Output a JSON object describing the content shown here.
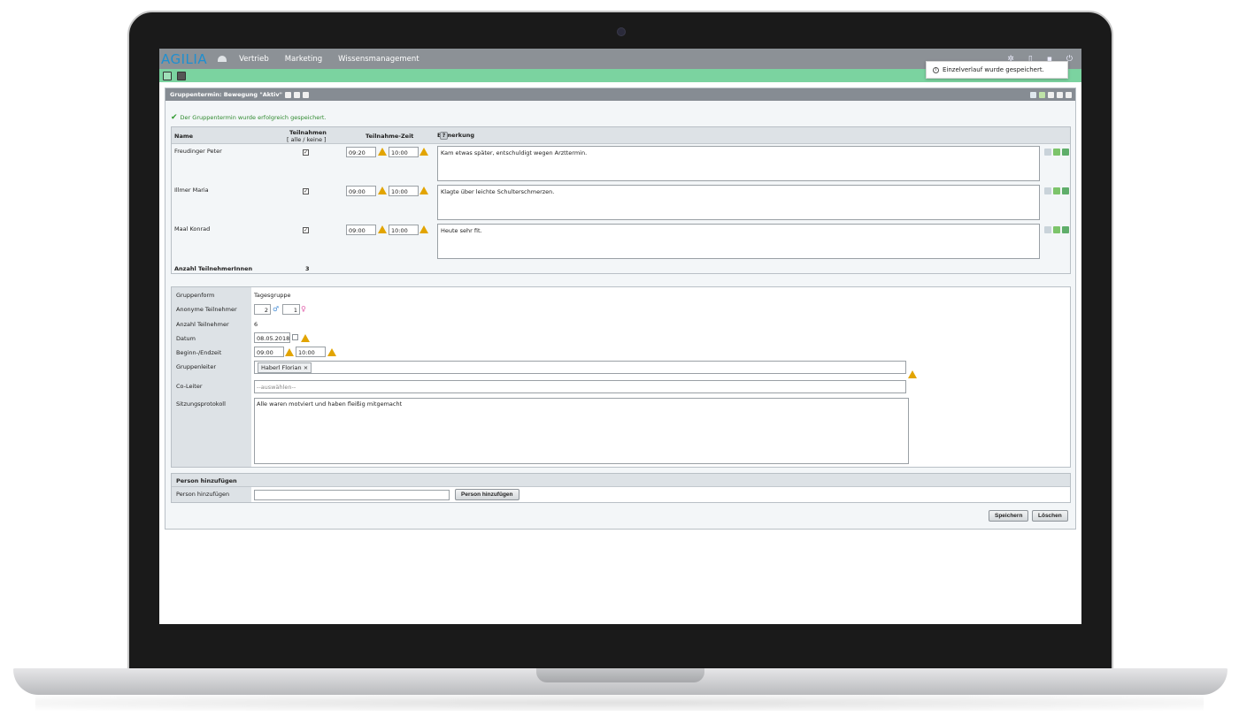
{
  "app": {
    "logo": "AGILIA",
    "nav": [
      "Vertrieb",
      "Marketing",
      "Wissensmanagement"
    ]
  },
  "toast": {
    "message": "Einzelverlauf wurde gespeichert."
  },
  "panel": {
    "title": "Gruppentermin: Bewegung \"Aktiv\"",
    "success_message": "Der Gruppentermin wurde erfolgreich gespeichert."
  },
  "participants": {
    "headers": {
      "name": "Name",
      "teilnahmen": "Teilnahmen",
      "alle_keine": "[ alle / keine ]",
      "zeit": "Teilnahme-Zeit",
      "bemerkung": "Bemerkung",
      "help": "?"
    },
    "rows": [
      {
        "name": "Freudinger Peter",
        "checked": true,
        "start": "09:20",
        "end": "10:00",
        "remark": "Kam etwas später, entschuldigt wegen Arzttermin."
      },
      {
        "name": "Illmer Maria",
        "checked": true,
        "start": "09:00",
        "end": "10:00",
        "remark": "Klagte über leichte Schulterschmerzen."
      },
      {
        "name": "Maal Konrad",
        "checked": true,
        "start": "09:00",
        "end": "10:00",
        "remark": "Heute sehr fit."
      }
    ],
    "count_label": "Anzahl TeilnehmerInnen",
    "count_value": "3"
  },
  "form": {
    "gruppenform_label": "Gruppenform",
    "gruppenform_value": "Tagesgruppe",
    "anonym_label": "Anonyme Teilnehmer",
    "anonym_male": "2",
    "anonym_female": "1",
    "anzahl_label": "Anzahl Teilnehmer",
    "anzahl_value": "6",
    "datum_label": "Datum",
    "datum_value": "08.05.2018",
    "zeit_label": "Beginn-/Endzeit",
    "beginn": "09:00",
    "ende": "10:00",
    "leiter_label": "Gruppenleiter",
    "leiter_tag": "Haberl Florian",
    "coleiter_label": "Co-Leiter",
    "coleiter_placeholder": "--auswählen--",
    "protokoll_label": "Sitzungsprotokoll",
    "protokoll_value": "Alle waren motviert und haben fleißig mitgemacht"
  },
  "add_person": {
    "section_title": "Person hinzufügen",
    "label": "Person hinzufügen",
    "button": "Person hinzufügen"
  },
  "actions": {
    "save": "Speichern",
    "delete": "Löschen"
  }
}
